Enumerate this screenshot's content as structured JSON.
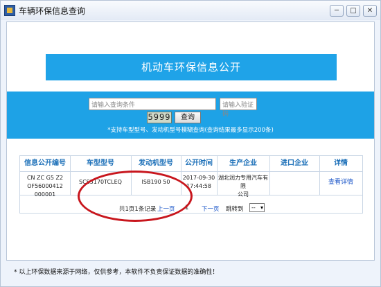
{
  "window": {
    "title": "车辆环保信息查询",
    "buttons": {
      "minimize": "─",
      "restore": "□",
      "close": "✕"
    }
  },
  "banner": {
    "title": "机动车环保信息公开"
  },
  "search": {
    "query_placeholder": "请输入查询条件",
    "captcha_placeholder": "请输入验证码",
    "captcha_code": "5999",
    "submit_label": "查询",
    "hint": "*支持车型型号、发动机型号模糊查询(查询结果最多显示200条)"
  },
  "table": {
    "headers": [
      "信息公开编号",
      "车型型号",
      "发动机型号",
      "公开时间",
      "生产企业",
      "进口企业",
      "详情"
    ],
    "rows": [
      {
        "info_no_line1": "CN ZC G5 Z2",
        "info_no_line2": "OF56000412 000001",
        "model": "SCS5170TCLEQ",
        "engine": "ISB190 50",
        "date_line1": "2017-09-30",
        "date_line2": "17:44:58",
        "maker_line1": "湖北润力专用汽车有限",
        "maker_line2": "公司",
        "importer": "",
        "detail_link": "查看详情"
      }
    ]
  },
  "pager": {
    "summary": "共1页1条记录",
    "prev": "上一页",
    "current": "1",
    "next": "下一页",
    "jump_label": "跳转到",
    "select_value": "--"
  },
  "footer": {
    "disclaimer": "* 以上环保数据来源于网络，仅供参考，本软件不负责保证数据的准确性！"
  },
  "colors": {
    "accent_blue": "#1fa3e8",
    "highlight_red": "#c8161d",
    "link_blue": "#1b56c8"
  }
}
